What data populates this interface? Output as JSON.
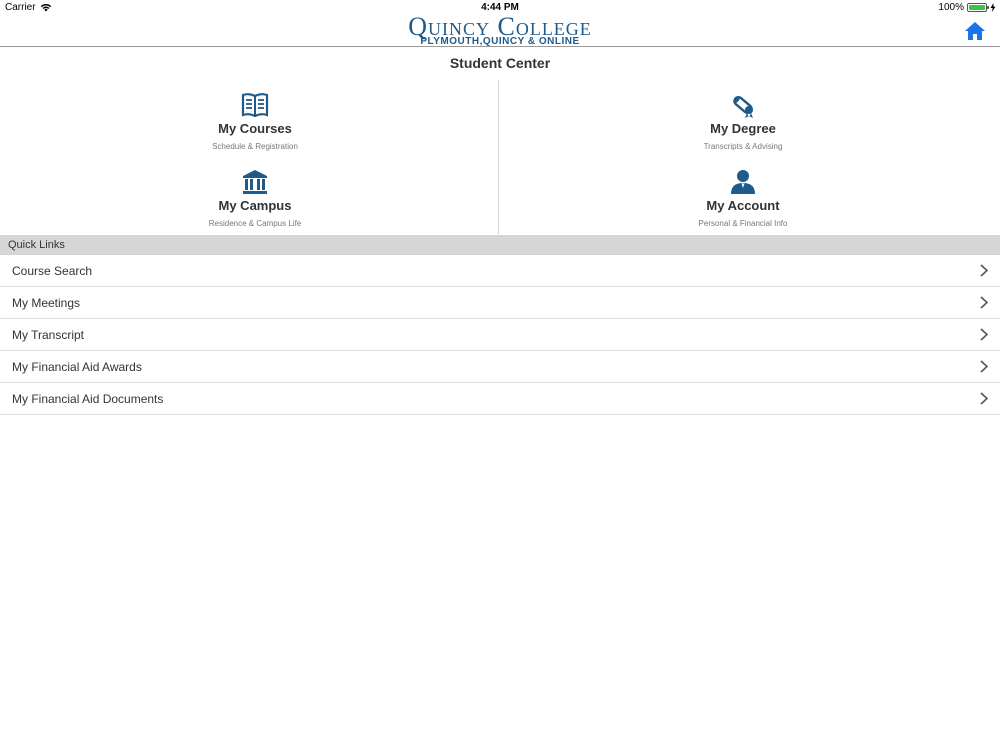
{
  "status_bar": {
    "carrier": "Carrier",
    "time": "4:44 PM",
    "battery": "100%",
    "battery_level": 1.0
  },
  "header": {
    "logo_main": "Quincy College",
    "logo_sub": "PLYMOUTH,QUINCY & ONLINE",
    "home_icon": "home-icon",
    "accent": "#1a73e8"
  },
  "main": {
    "title": "Student Center",
    "tiles": [
      {
        "title": "My Courses",
        "subtitle": "Schedule & Registration",
        "icon": "book-icon"
      },
      {
        "title": "My Degree",
        "subtitle": "Transcripts & Advising",
        "icon": "diploma-icon"
      },
      {
        "title": "My Campus",
        "subtitle": "Residence & Campus Life",
        "icon": "building-icon"
      },
      {
        "title": "My Account",
        "subtitle": "Personal & Financial Info",
        "icon": "user-icon"
      }
    ],
    "icon_color": "#1e5a8a"
  },
  "quick_links": {
    "header": "Quick Links",
    "items": [
      {
        "label": "Course Search"
      },
      {
        "label": "My Meetings"
      },
      {
        "label": "My Transcript"
      },
      {
        "label": "My Financial Aid Awards"
      },
      {
        "label": "My Financial Aid Documents"
      }
    ]
  }
}
